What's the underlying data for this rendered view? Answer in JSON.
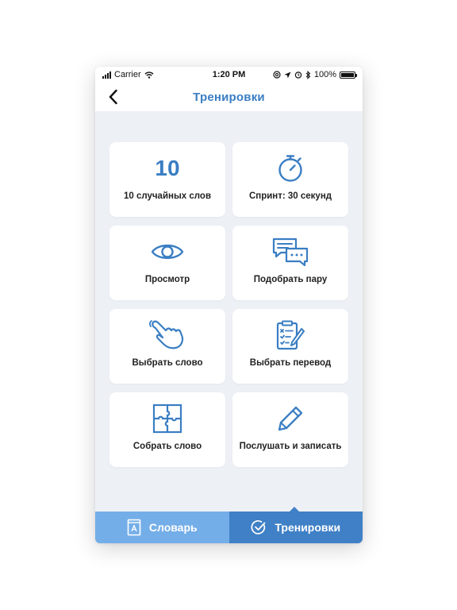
{
  "status_bar": {
    "carrier": "Carrier",
    "time": "1:20 PM",
    "battery": "100%"
  },
  "header": {
    "title": "Тренировки",
    "back_icon": "chevron-left-icon"
  },
  "cards": [
    {
      "id": "random-words",
      "number": "10",
      "label": "10 случайных слов"
    },
    {
      "id": "sprint",
      "icon": "stopwatch-icon",
      "label": "Спринт: 30 секунд"
    },
    {
      "id": "view",
      "icon": "eye-icon",
      "label": "Просмотр"
    },
    {
      "id": "match-pair",
      "icon": "chat-bubbles-icon",
      "label": "Подобрать пару"
    },
    {
      "id": "choose-word",
      "icon": "pointing-hand-icon",
      "label": "Выбрать слово"
    },
    {
      "id": "choose-translation",
      "icon": "clipboard-checklist-icon",
      "label": "Выбрать перевод"
    },
    {
      "id": "assemble-word",
      "icon": "puzzle-icon",
      "label": "Собрать слово"
    },
    {
      "id": "listen-write",
      "icon": "pencil-icon",
      "label": "Послушать и записать"
    }
  ],
  "tabs": [
    {
      "label": "Словарь",
      "icon": "dictionary-book-icon",
      "active": false
    },
    {
      "label": "Тренировки",
      "icon": "check-circle-icon",
      "active": true
    }
  ],
  "colors": {
    "accent": "#3a7ec3",
    "tab_active": "#3f80c6",
    "tab_inactive": "#74aee8",
    "background": "#edf1f6"
  }
}
